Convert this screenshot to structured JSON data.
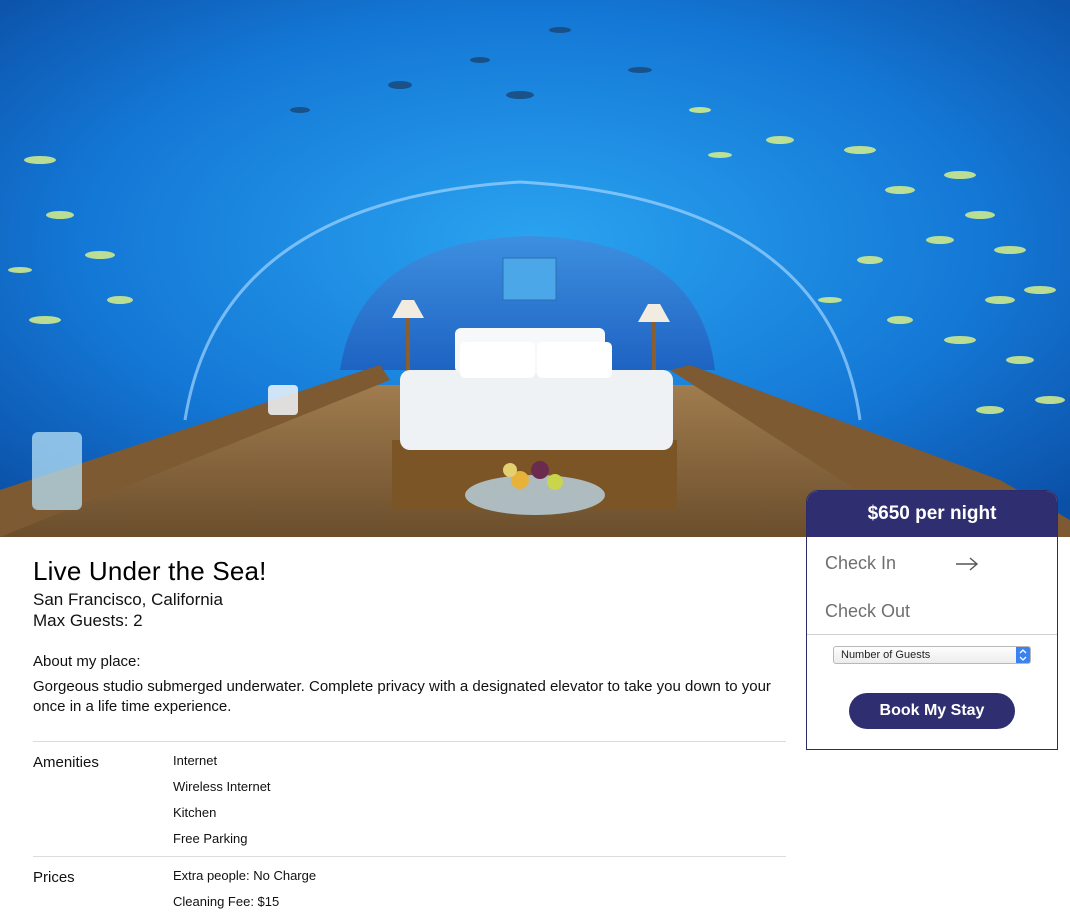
{
  "hero": {
    "image_alt": "Underwater bedroom with glass tunnel ceiling and fish"
  },
  "listing": {
    "title": "Live Under the Sea!",
    "location": "San Francisco, California",
    "max_guests": "Max Guests: 2",
    "about_label": "About my place:",
    "about_text": "Gorgeous studio submerged underwater. Complete privacy with a designated elevator to take you down to your once in a life time experience."
  },
  "amenities": {
    "label": "Amenities",
    "items": [
      "Internet",
      "Wireless Internet",
      "Kitchen",
      "Free Parking"
    ]
  },
  "prices": {
    "label": "Prices",
    "items": [
      "Extra people: No Charge",
      "Cleaning Fee: $15"
    ]
  },
  "booking": {
    "price": "$650 per night",
    "check_in": "Check In",
    "check_out": "Check Out",
    "guests_select": "Number of Guests",
    "book_button": "Book My Stay",
    "colors": {
      "accent": "#2e2e70",
      "select_accent": "#3b82f1"
    }
  }
}
